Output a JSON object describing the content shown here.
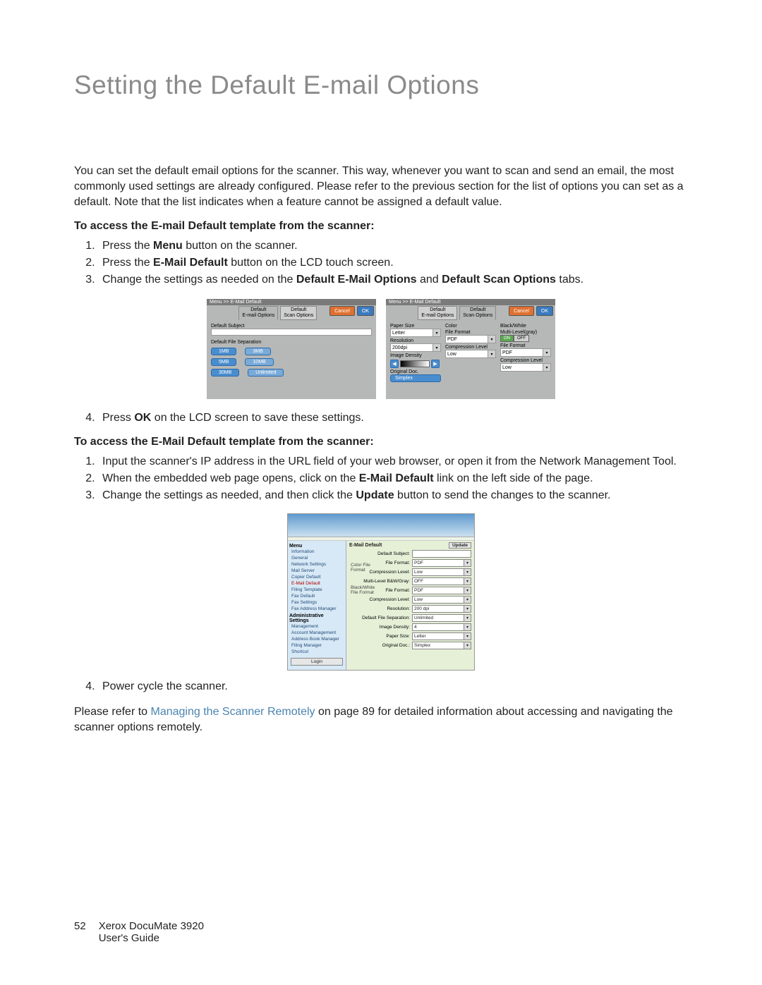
{
  "title": "Setting the Default E-mail Options",
  "intro": "You can set the default email options for the scanner. This way, whenever you want to scan and send an email, the most commonly used settings are already configured. Please refer to the previous section for the list of options you can set as a default. Note that the list indicates when a feature cannot be assigned a default value.",
  "section1": {
    "heading": "To access the E-mail Default template from the scanner:",
    "steps_1_3": {
      "s1_a": "Press the ",
      "s1_b": "Menu",
      "s1_c": " button on the scanner.",
      "s2_a": "Press the ",
      "s2_b": "E-Mail Default",
      "s2_c": " button on the LCD touch screen.",
      "s3_a": "Change the settings as needed on the ",
      "s3_b": "Default E-Mail Options",
      "s3_c": " and ",
      "s3_d": "Default Scan Options",
      "s3_e": " tabs."
    },
    "step4_a": "Press ",
    "step4_b": "OK",
    "step4_c": " on the LCD screen to save these settings."
  },
  "section2": {
    "heading": "To access the E-Mail Default template from the scanner:",
    "steps_1_3": {
      "s1": "Input the scanner's IP address in the URL field of your web browser, or open it from the Network Management Tool.",
      "s2_a": "When the embedded web page opens, click on the ",
      "s2_b": "E-Mail Default",
      "s2_c": " link on the left side of the page.",
      "s3_a": "Change the settings as needed, and then click the ",
      "s3_b": "Update",
      "s3_c": " button to send the changes to the scanner."
    },
    "step4": "Power cycle the scanner."
  },
  "closing_a": "Please refer to ",
  "closing_link": "Managing the Scanner Remotely",
  "closing_b": " on page 89 for detailed information about accessing and navigating the scanner options remotely.",
  "footer": {
    "page": "52",
    "line1": "Xerox DocuMate 3920",
    "line2": "User's Guide"
  },
  "lcd1": {
    "crumb": "Menu >> E-Mail Default",
    "tab1": "Default\nE-mail Options",
    "tab2": "Default\nScan Options",
    "cancel": "Cancel",
    "ok": "OK",
    "lbl_subject": "Default Subject",
    "lbl_sep": "Default File Separation",
    "pills": [
      "1MB",
      "3MB",
      "5MB",
      "10MB",
      "30MB",
      "Unlimited"
    ]
  },
  "lcd2": {
    "crumb": "Menu >> E-Mail Default",
    "tab1": "Default\nE-mail Options",
    "tab2": "Default\nScan Options",
    "cancel": "Cancel",
    "ok": "OK",
    "col1": {
      "l1": "Paper Size",
      "v1": "Letter",
      "l2": "Resolution",
      "v2": "200dpi",
      "l3": "Image Density",
      "l4": "Original Doc.",
      "v4": "Simplex"
    },
    "col2": {
      "l1": "Color",
      "l2": "File Format",
      "v2": "PDF",
      "l3": "Compression Level",
      "v3": "Low"
    },
    "col3": {
      "l1": "Black/White",
      "l2": "Multi-Level(gray)",
      "on": "ON",
      "off": "OFF",
      "l3": "File Format",
      "v3": "PDF",
      "l4": "Compression Level",
      "v4": "Low"
    }
  },
  "web": {
    "menu_hdr": "Menu",
    "items": [
      "Information",
      "General",
      "Network Settings",
      "Mail Server",
      "Copier Default",
      "E-Mail Default",
      "Filing Template",
      "Fax Default",
      "Fax Settings",
      "Fax Address Manager"
    ],
    "admin_hdr": "Administrative Settings",
    "admin_items": [
      "Management",
      "Account Management",
      "Address Book Manager",
      "Filing Manager",
      "Shortcut"
    ],
    "login": "Login",
    "title": "E-Mail Default",
    "update": "Update",
    "grp1": "Color File\nFormat",
    "grp2": "Black/White\nFile Format",
    "rows": {
      "r1": {
        "l": "Default Subject:",
        "v": ""
      },
      "r2": {
        "l": "File Format:",
        "v": "PDF"
      },
      "r3": {
        "l": "Compression Level:",
        "v": "Low"
      },
      "r4": {
        "l": "Multi-Level B&W/Gray:",
        "v": "OFF"
      },
      "r5": {
        "l": "File Format:",
        "v": "PDF"
      },
      "r6": {
        "l": "Compression Level:",
        "v": "Low"
      },
      "r7": {
        "l": "Resolution:",
        "v": "200 dpi"
      },
      "r8": {
        "l": "Default File Separation:",
        "v": "Unlimited"
      },
      "r9": {
        "l": "Image Density:",
        "v": "4"
      },
      "r10": {
        "l": "Paper Size:",
        "v": "Letter"
      },
      "r11": {
        "l": "Original Doc.:",
        "v": "Simplex"
      }
    }
  }
}
